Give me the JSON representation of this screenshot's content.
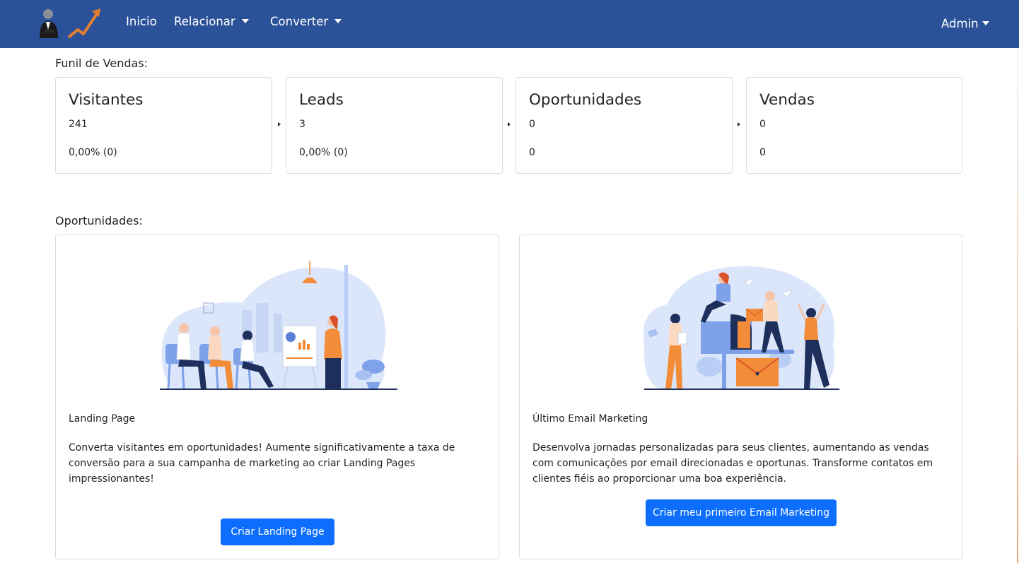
{
  "navbar": {
    "logo_icon": "businessman-growth-arrow-logo",
    "inicio": "Inicio",
    "relacionar": "Relacionar",
    "converter": "Converter",
    "admin": "Admin",
    "background": "#2b5299"
  },
  "funnel": {
    "title": "Funil de Vendas:",
    "cards": [
      {
        "title": "Visitantes",
        "value": "241",
        "rate": "0,00% (0)"
      },
      {
        "title": "Leads",
        "value": "3",
        "rate": "0,00% (0)"
      },
      {
        "title": "Oportunidades",
        "value": "0",
        "rate": "0"
      },
      {
        "title": "Vendas",
        "value": "0",
        "rate": "0"
      }
    ]
  },
  "opportunities": {
    "title": "Oportunidades:",
    "cards": [
      {
        "illustration": "team-meeting-presentation-illustration",
        "title": "Landing Page",
        "text": "Converta visitantes em oportunidades! Aumente significativamente a taxa de conversão para a sua campanha de marketing ao criar Landing Pages impressionantes!",
        "button": "Criar Landing Page"
      },
      {
        "illustration": "email-marketing-mailbox-illustration",
        "title": "Último Email Marketing",
        "text": "Desenvolva jornadas personalizadas para seus clientes, aumentando as vendas com comunicações por email direcionadas e oportunas. Transforme contatos em clientes fiéis ao proporcionar uma boa experiência.",
        "button": "Criar meu primeiro Email Marketing"
      }
    ]
  },
  "colors": {
    "primary_button": "#0d6efd",
    "illustration_blue": "#dbe6fb",
    "illustration_orange": "#f28c38",
    "illustration_navy": "#1e2f5c"
  }
}
